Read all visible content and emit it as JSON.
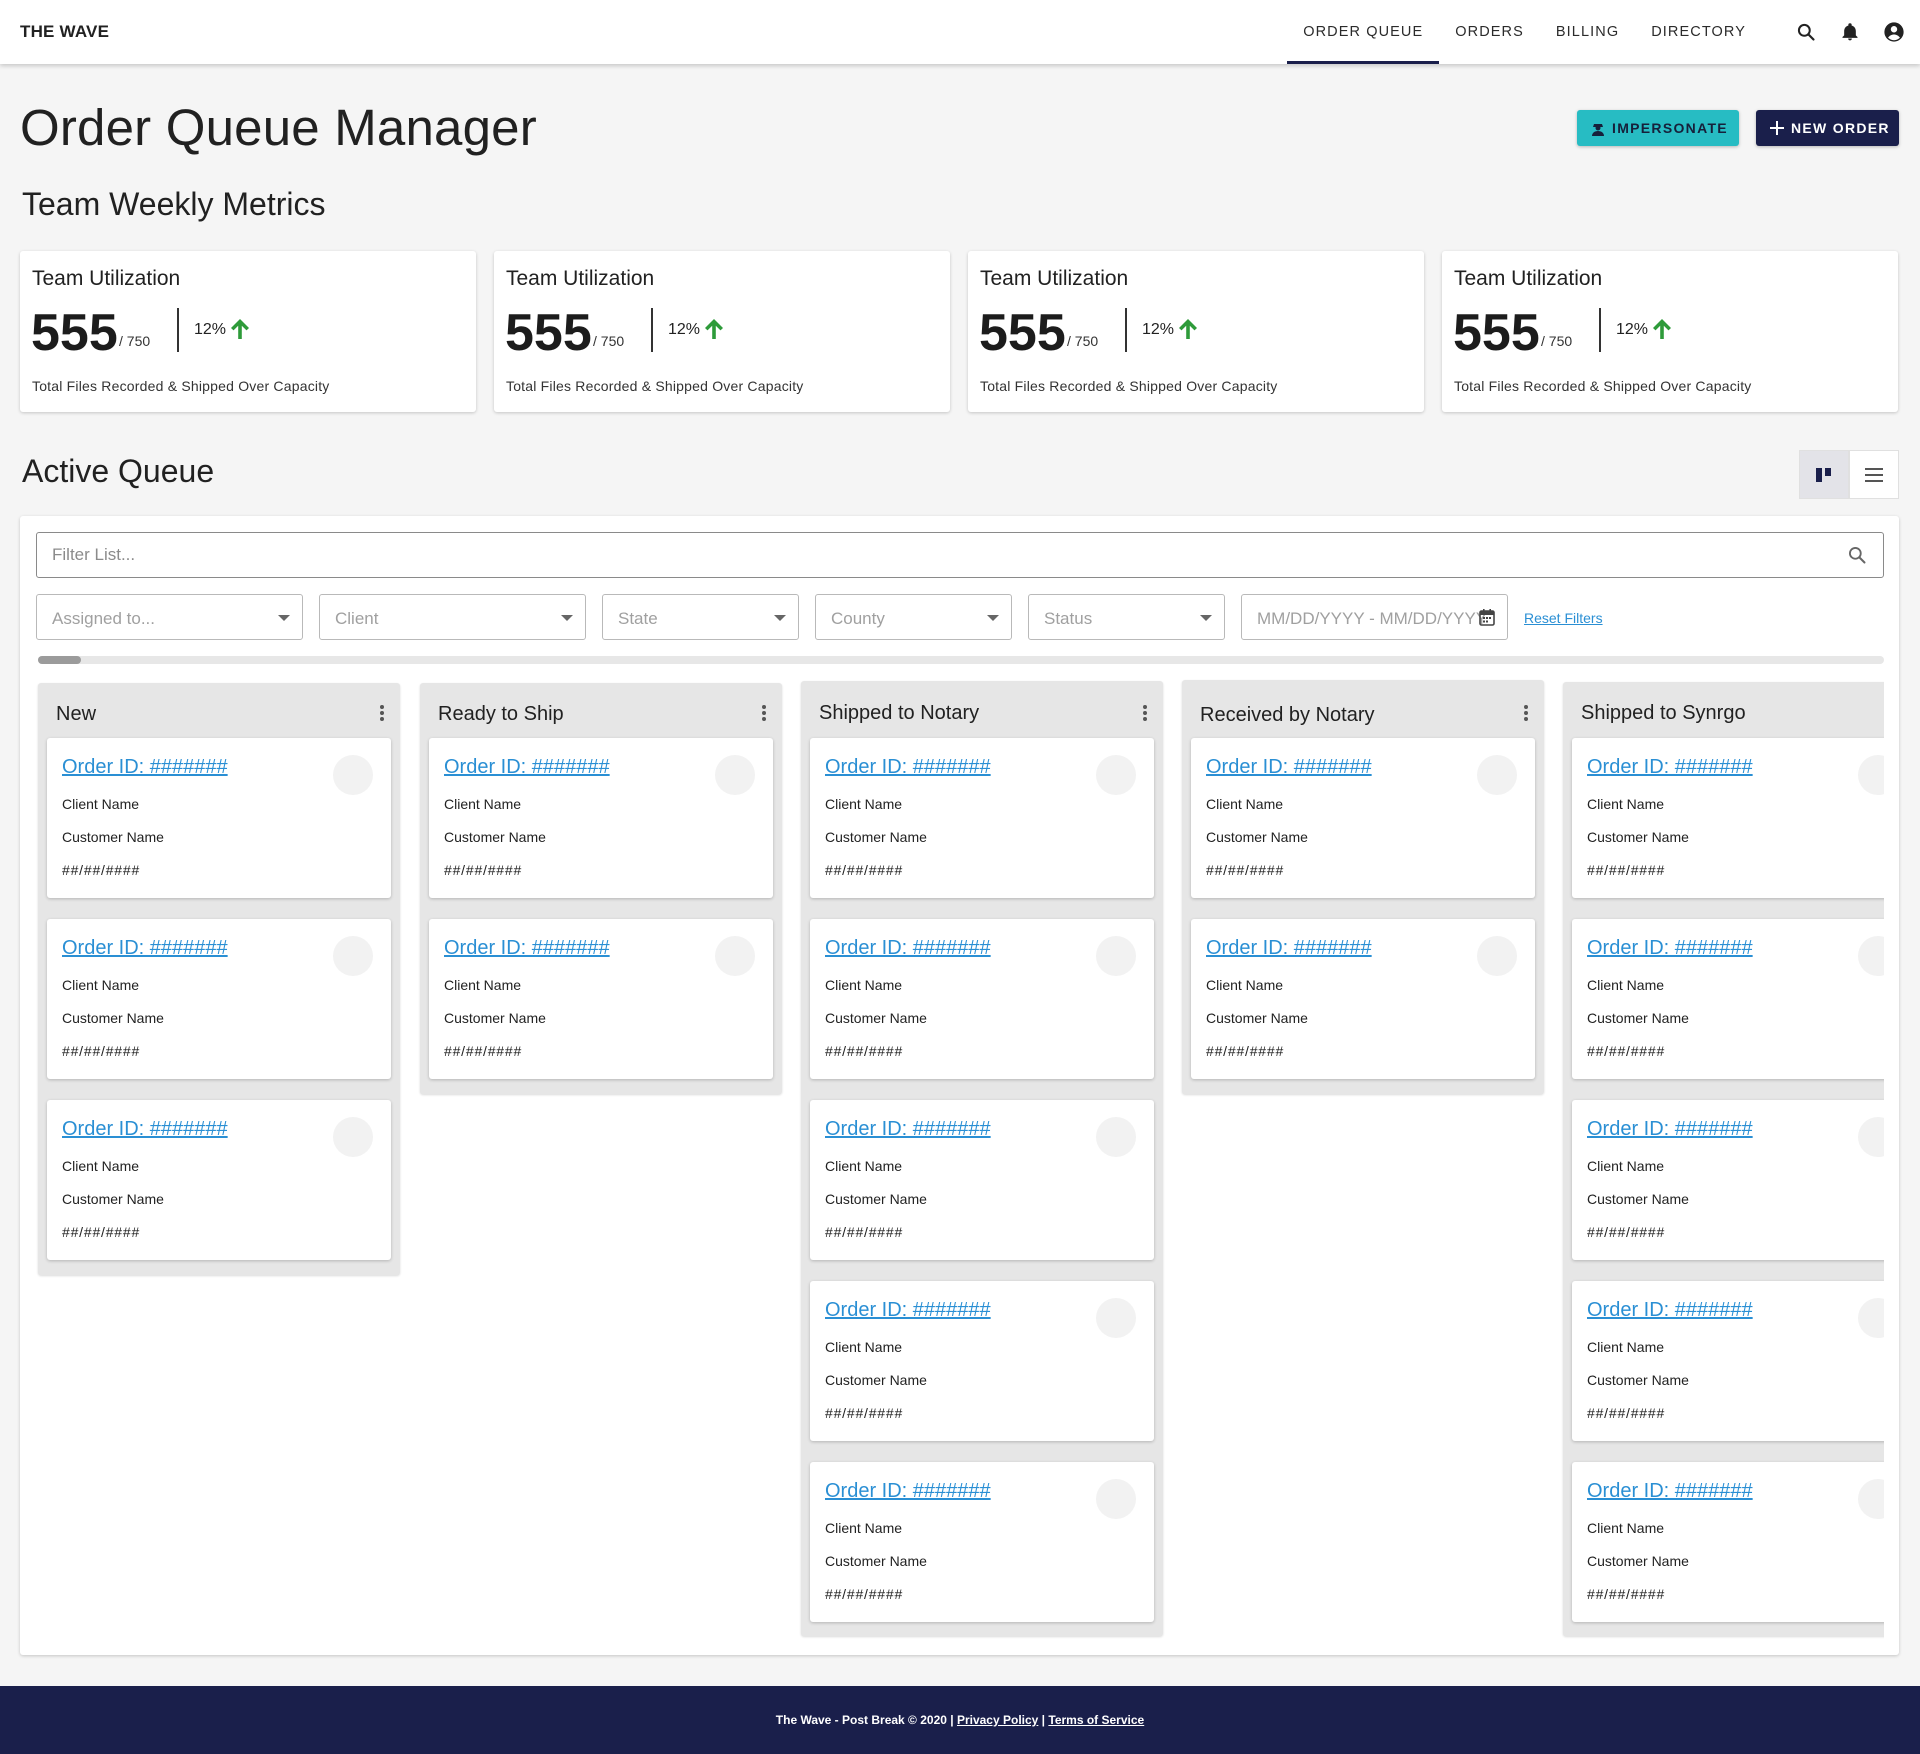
{
  "nav": {
    "brand": "THE WAVE",
    "links": [
      {
        "label": "ORDER QUEUE",
        "active": true
      },
      {
        "label": "ORDERS"
      },
      {
        "label": "BILLING"
      },
      {
        "label": "DIRECTORY"
      }
    ],
    "icons": [
      "search-icon",
      "bell-icon",
      "account-icon"
    ]
  },
  "header": {
    "title": "Order Queue Manager",
    "impersonate_label": "IMPERSONATE",
    "new_order_label": "NEW ORDER"
  },
  "metrics": {
    "title": "Team Weekly Metrics",
    "cards": [
      {
        "title": "Team Utilization",
        "value": "555",
        "capacity": "/ 750",
        "change": "12%",
        "description": "Total Files Recorded & Shipped Over Capacity"
      },
      {
        "title": "Team Utilization",
        "value": "555",
        "capacity": "/ 750",
        "change": "12%",
        "description": "Total Files Recorded & Shipped Over Capacity"
      },
      {
        "title": "Team Utilization",
        "value": "555",
        "capacity": "/ 750",
        "change": "12%",
        "description": "Total Files Recorded & Shipped Over Capacity"
      },
      {
        "title": "Team Utilization",
        "value": "555",
        "capacity": "/ 750",
        "change": "12%",
        "description": "Total Files Recorded & Shipped Over Capacity"
      }
    ]
  },
  "queue": {
    "title": "Active Queue",
    "filter_placeholder": "Filter List...",
    "filters": {
      "assigned": "Assigned to...",
      "client": "Client",
      "state": "State",
      "county": "County",
      "status": "Status",
      "date_range": "MM/DD/YYYY - MM/DD/YYYY",
      "reset": "Reset Filters"
    },
    "columns": [
      {
        "title": "New"
      },
      {
        "title": "Ready to Ship"
      },
      {
        "title": "Shipped to Notary"
      },
      {
        "title": "Received by Notary"
      },
      {
        "title": "Shipped to Synrgo"
      }
    ],
    "card": {
      "order_id": "Order ID: #######",
      "client": "Client Name",
      "customer": "Customer Name",
      "date": "##/##/####"
    }
  },
  "footer": {
    "text": "The Wave - Post Break © 2020 | ",
    "privacy": "Privacy Policy",
    "separator": " | ",
    "terms": "Terms of Service"
  },
  "colors": {
    "primary": "#1a1f4b",
    "accent": "#27bcc3",
    "link": "#2a8fd4",
    "positive": "#2e9b3a"
  }
}
